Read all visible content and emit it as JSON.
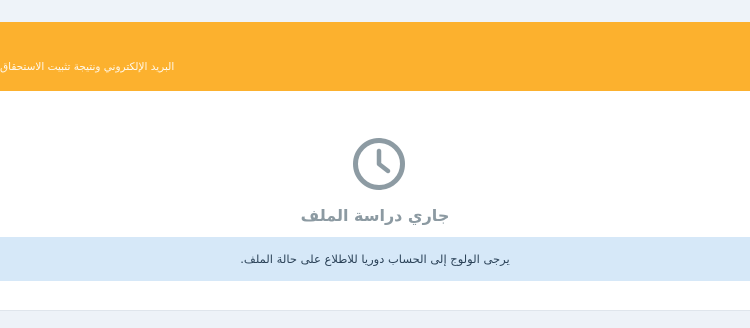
{
  "banner": {
    "text": "البريد الإلكتروني ونتيجة تثبيت الاستحقاق",
    "color": "#fcb12e"
  },
  "status": {
    "icon": "clock-icon",
    "title": "جاري دراسة الملف"
  },
  "info": {
    "message": "يرجى الولوج إلى الحساب دوريا للاطلاع على حالة الملف.",
    "color": "#d6e8f8"
  }
}
